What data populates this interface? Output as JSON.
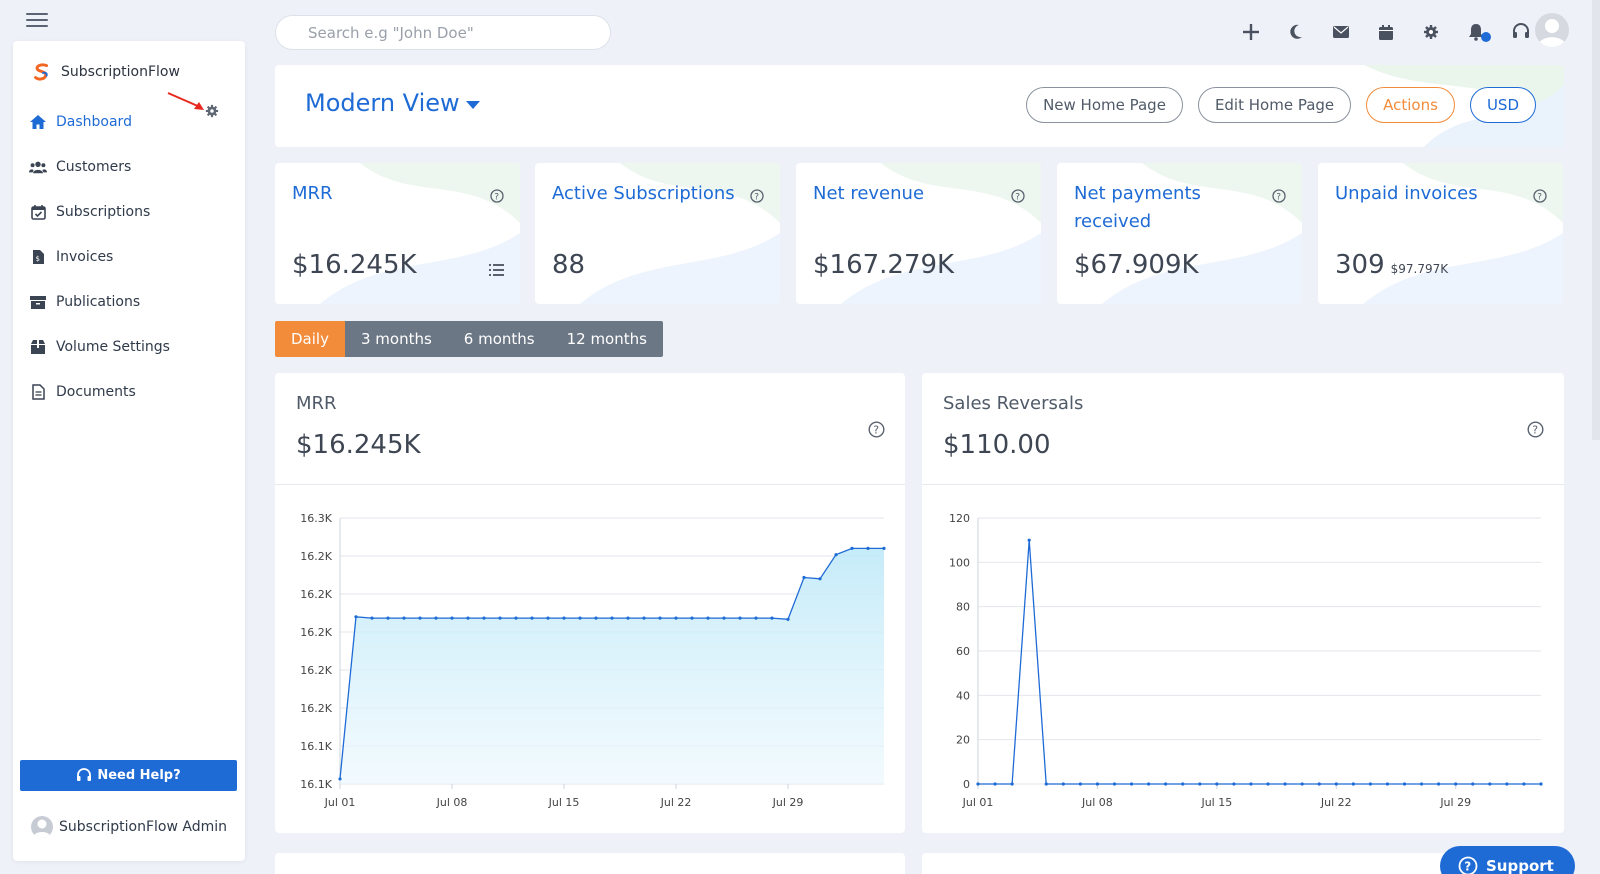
{
  "brand": {
    "name": "SubscriptionFlow"
  },
  "search": {
    "placeholder": "Search e.g \"John Doe\""
  },
  "sidebar": {
    "items": [
      {
        "label": "Dashboard",
        "icon": "home-icon"
      },
      {
        "label": "Customers",
        "icon": "users-icon"
      },
      {
        "label": "Subscriptions",
        "icon": "calendar-check-icon"
      },
      {
        "label": "Invoices",
        "icon": "invoice-icon"
      },
      {
        "label": "Publications",
        "icon": "archive-icon"
      },
      {
        "label": "Volume Settings",
        "icon": "box-icon"
      },
      {
        "label": "Documents",
        "icon": "document-icon"
      }
    ],
    "need_help": "Need Help?",
    "admin_name": "SubscriptionFlow Admin"
  },
  "topbar": {
    "icons": [
      "plus-icon",
      "moon-icon",
      "mail-icon",
      "calendar-icon",
      "gear-icon",
      "bell-icon",
      "headset-icon"
    ]
  },
  "header": {
    "view_title": "Modern View",
    "buttons": {
      "new_home": "New Home Page",
      "edit_home": "Edit Home Page",
      "actions": "Actions",
      "currency": "USD"
    }
  },
  "stats": [
    {
      "title": "MRR",
      "value": "$16.245K",
      "sub": ""
    },
    {
      "title": "Active Subscriptions",
      "value": "88",
      "sub": ""
    },
    {
      "title": "Net revenue",
      "value": "$167.279K",
      "sub": ""
    },
    {
      "title": "Net payments received",
      "value": "$67.909K",
      "sub": ""
    },
    {
      "title": "Unpaid invoices",
      "value": "309",
      "sub": "$97.797K"
    }
  ],
  "periods": [
    "Daily",
    "3 months",
    "6 months",
    "12 months"
  ],
  "charts": {
    "mrr": {
      "title": "MRR",
      "value": "$16.245K"
    },
    "reversals": {
      "title": "Sales Reversals",
      "value": "$110.00"
    }
  },
  "support_label": "Support",
  "colors": {
    "accent": "#1e6bd6",
    "orange": "#f28b3a",
    "tab_gray": "#6c7785"
  },
  "chart_data": [
    {
      "type": "area",
      "title": "MRR",
      "x_ticks": [
        "Jul 01",
        "Jul 08",
        "Jul 15",
        "Jul 22",
        "Jul 29"
      ],
      "y_tick_labels": [
        "16.3K",
        "16.2K",
        "16.2K",
        "16.2K",
        "16.2K",
        "16.2K",
        "16.1K",
        "16.1K"
      ],
      "ylim": [
        16100,
        16310
      ],
      "series": [
        {
          "values": [
            16104,
            16232,
            16231,
            16231,
            16231,
            16231,
            16231,
            16231,
            16231,
            16231,
            16231,
            16231,
            16231,
            16231,
            16231,
            16231,
            16231,
            16231,
            16231,
            16231,
            16231,
            16231,
            16231,
            16231,
            16231,
            16231,
            16231,
            16231,
            16230,
            16263,
            16262,
            16281,
            16286,
            16286,
            16286
          ]
        }
      ]
    },
    {
      "type": "line",
      "title": "Sales Reversals",
      "x_ticks": [
        "Jul 01",
        "Jul 08",
        "Jul 15",
        "Jul 22",
        "Jul 29"
      ],
      "y_ticks": [
        0,
        20,
        40,
        60,
        80,
        100,
        120
      ],
      "ylim": [
        0,
        120
      ],
      "series": [
        {
          "values": [
            0,
            0,
            0,
            110,
            0,
            0,
            0,
            0,
            0,
            0,
            0,
            0,
            0,
            0,
            0,
            0,
            0,
            0,
            0,
            0,
            0,
            0,
            0,
            0,
            0,
            0,
            0,
            0,
            0,
            0,
            0,
            0,
            0,
            0
          ]
        }
      ]
    }
  ]
}
